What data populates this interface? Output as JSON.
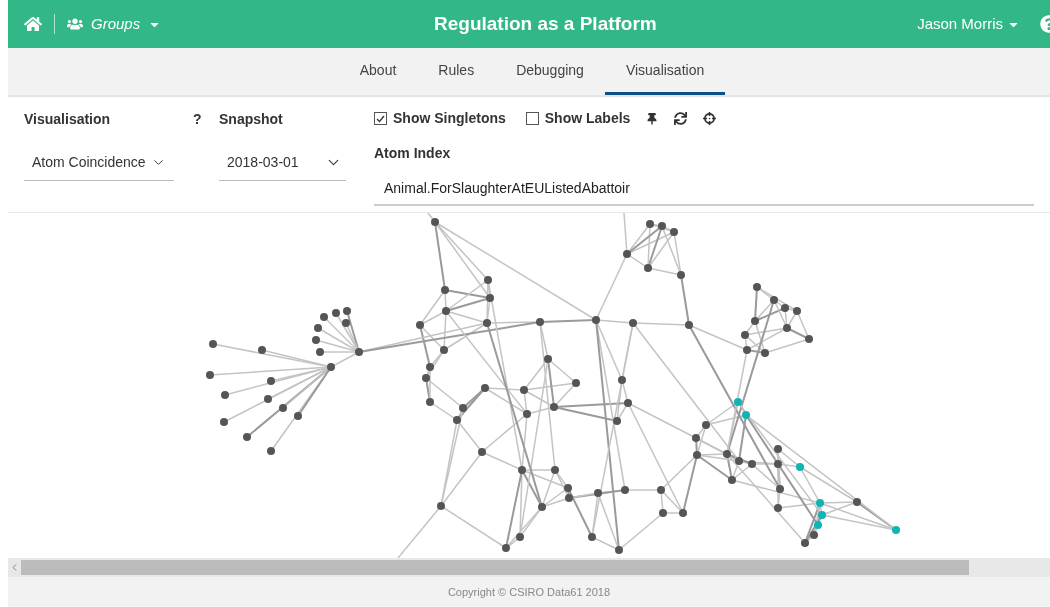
{
  "header": {
    "groups_menu": "Groups",
    "title": "Regulation as a Platform",
    "user_menu": "Jason Morris"
  },
  "tabs": [
    {
      "label": "About",
      "selected": false
    },
    {
      "label": "Rules",
      "selected": false
    },
    {
      "label": "Debugging",
      "selected": false
    },
    {
      "label": "Visualisation",
      "selected": true
    }
  ],
  "controls": {
    "visualisation": {
      "label": "Visualisation",
      "help": "?",
      "value": "Atom Coincidence"
    },
    "snapshot": {
      "label": "Snapshot",
      "value": "2018-03-01"
    },
    "options": [
      {
        "label": "Show Singletons",
        "checked": true
      },
      {
        "label": "Show Labels",
        "checked": false
      }
    ],
    "atom_index": {
      "label": "Atom Index",
      "value": "Animal.ForSlaughterAtEUListedAbattoir"
    }
  },
  "footer": "Copyright © CSIRO Data61 2018"
}
